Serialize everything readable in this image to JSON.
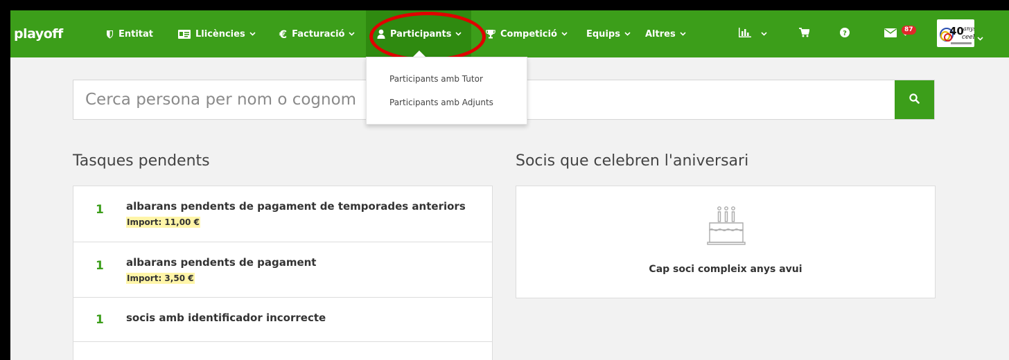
{
  "navbar": {
    "brand": "playoff",
    "items": [
      {
        "label": "Entitat",
        "icon": "shield-icon"
      },
      {
        "label": "Llicències",
        "icon": "id-card-icon"
      },
      {
        "label": "Facturació",
        "icon": "euro-icon"
      },
      {
        "label": "Participants",
        "icon": "user-icon",
        "active": true
      },
      {
        "label": "Competició",
        "icon": "trophy-icon"
      },
      {
        "label": "Equips"
      },
      {
        "label": "Altres"
      }
    ],
    "right_icons": [
      "bar-chart-icon",
      "cart-icon",
      "help-icon",
      "mail-icon"
    ],
    "mail_badge": "87",
    "logo_alt": "40 anys ceeb"
  },
  "search": {
    "placeholder": "Cerca persona per nom o cognom"
  },
  "dropdown": {
    "items": [
      "Participants amb Tutor",
      "Participants amb Adjunts"
    ]
  },
  "tasks": {
    "title": "Tasques pendents",
    "items": [
      {
        "count": "1",
        "title": "albarans pendents de pagament de temporades anteriors",
        "import": "Import: 11,00 €"
      },
      {
        "count": "1",
        "title": "albarans pendents de pagament",
        "import": "Import: 3,50 €"
      },
      {
        "count": "1",
        "title": "socis amb identificador incorrecte",
        "import": ""
      },
      {
        "count": "",
        "title": "",
        "import": ""
      }
    ]
  },
  "birthdays": {
    "title": "Socis que celebren l'aniversari",
    "message": "Cap soci compleix anys avui"
  },
  "colors": {
    "brand_green": "#3c9e1a",
    "highlight_red": "#e00000",
    "badge_red": "#e0282a",
    "import_highlight": "#fff5a8"
  }
}
